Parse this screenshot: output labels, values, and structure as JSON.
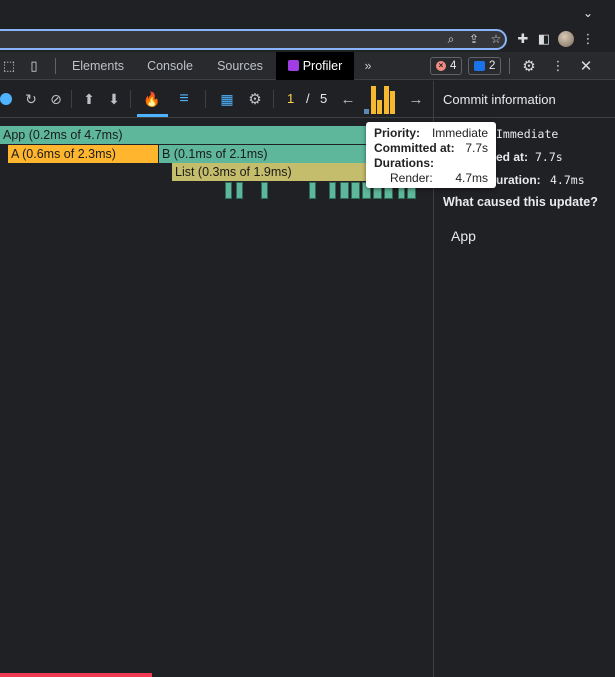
{
  "devtools_tabs": [
    {
      "label": "Elements"
    },
    {
      "label": "Console"
    },
    {
      "label": "Sources"
    },
    {
      "label": "Profiler"
    },
    {
      "label": "»"
    }
  ],
  "badges": {
    "errors": "4",
    "messages": "2"
  },
  "profiler_toolbar": {
    "commit_current": "1",
    "commit_separator": "/",
    "commit_total": "5"
  },
  "commit_bar_values_ms": [
    0.9,
    4.7,
    2.3,
    4.7,
    3.9
  ],
  "flame_graph": {
    "app": "App (0.2ms of 4.7ms)",
    "a": "A (0.6ms of 2.3ms)",
    "b": "B (0.1ms of 2.1ms)",
    "list": "List (0.3ms of 1.9ms)"
  },
  "tooltip": {
    "priority_label": "Priority:",
    "priority_value": "Immediate",
    "committed_label": "Committed at:",
    "committed_value": "7.7s",
    "durations_label": "Durations:",
    "render_label": "Render:",
    "render_value": "4.7ms"
  },
  "side_panel": {
    "title": "Commit information",
    "priority_value": "Immediate",
    "committed_label_partial": "ed at:",
    "committed_value": "7.7s",
    "duration_label_partial": "uration:",
    "duration_value": "4.7ms",
    "question": "What caused this update?",
    "cause": "App"
  },
  "colors": {
    "accent_blue": "#4fb3ff",
    "flame_green": "#5eb79a",
    "flame_orange": "#ffb62e",
    "flame_olive": "#c4bd6b",
    "commit_bar_yellow": "#f5b82e",
    "commit_bar_selected": "#5b8ab8"
  }
}
